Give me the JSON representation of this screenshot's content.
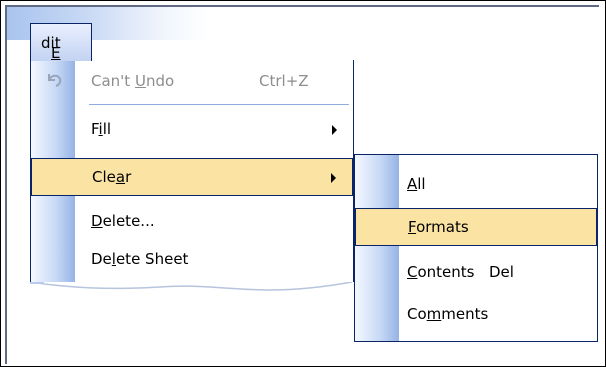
{
  "menubar": {
    "edit_label": "Edit"
  },
  "edit_menu": {
    "items": [
      {
        "label": "Can't Undo",
        "shortcut": "Ctrl+Z",
        "icon": "undo-icon",
        "disabled": true
      },
      {
        "label": "Fill",
        "submenu": true
      },
      {
        "label": "Clear",
        "submenu": true,
        "selected": true
      },
      {
        "label": "Delete..."
      },
      {
        "label": "Delete Sheet"
      }
    ]
  },
  "clear_submenu": {
    "items": [
      {
        "label": "All"
      },
      {
        "label": "Formats",
        "selected": true
      },
      {
        "label": "Contents",
        "shortcut": "Del"
      },
      {
        "label": "Comments"
      }
    ]
  },
  "colors": {
    "selection": "#fbe3a4",
    "border": "#0a246a",
    "gutter": "#96b3e6"
  }
}
